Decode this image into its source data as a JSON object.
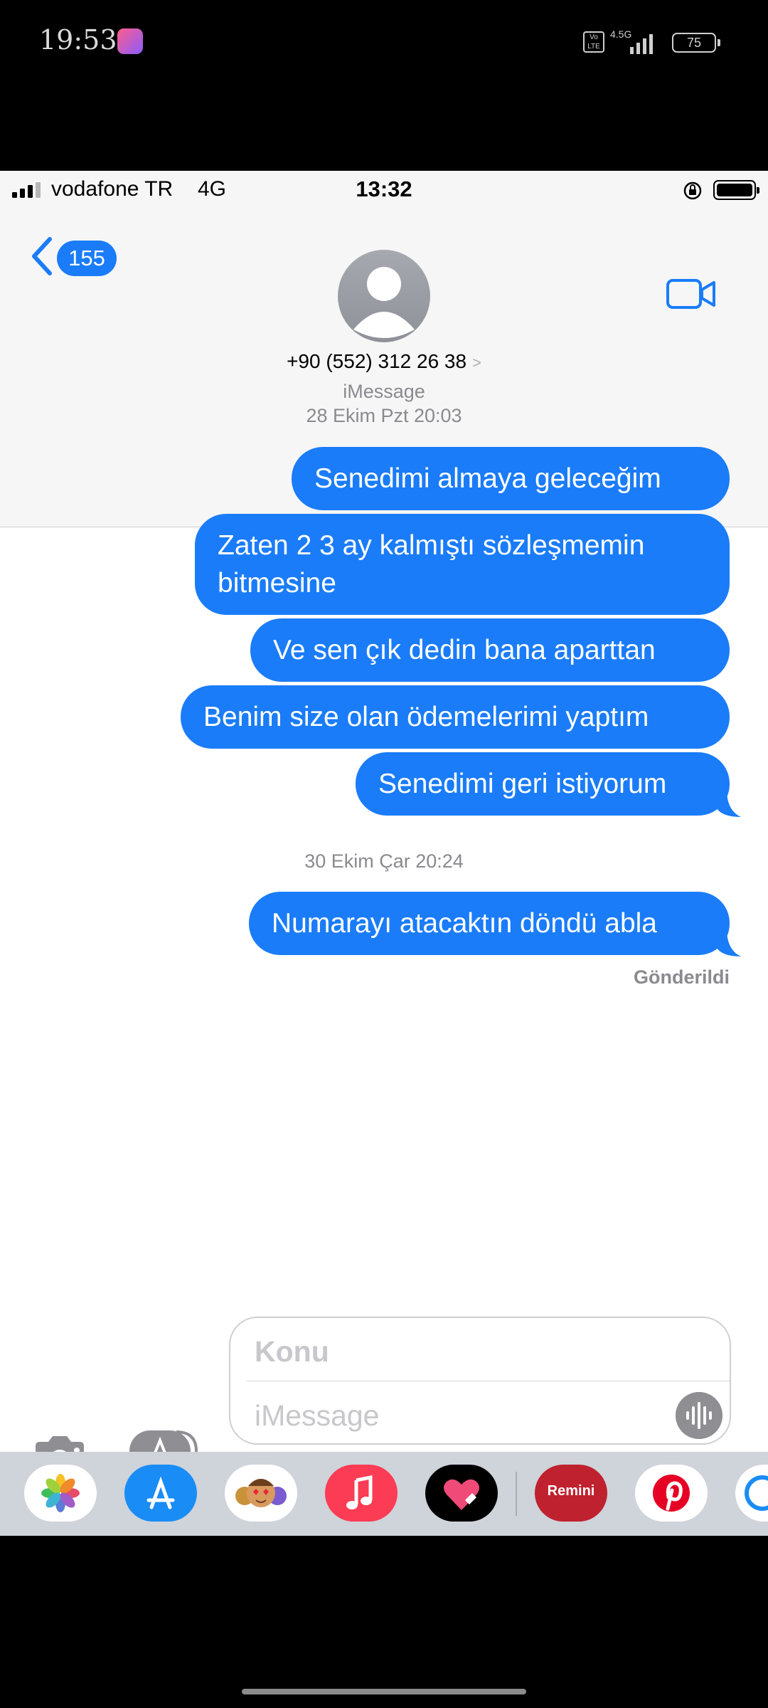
{
  "android_status": {
    "time": "19:53",
    "volte": "Vo LTE",
    "network": "4.5G",
    "battery": "75"
  },
  "ios_status": {
    "carrier": "vodafone TR",
    "network": "4G",
    "time": "13:32"
  },
  "nav": {
    "back_count": "155",
    "contact": "+90 (552) 312 26 38",
    "contact_chevron": ">"
  },
  "conversation": {
    "service": "iMessage",
    "groups": [
      {
        "timestamp": "28 Ekim Pzt 20:03",
        "messages": [
          {
            "text": "Senedimi almaya geleceğim"
          },
          {
            "text": "Zaten 2 3 ay kalmıştı sözleşmemin bitmesine"
          },
          {
            "text": "Ve sen çık dedin bana aparttan"
          },
          {
            "text": "Benim size olan ödemelerimi yaptım"
          },
          {
            "text": "Senedimi geri istiyorum"
          }
        ]
      },
      {
        "timestamp": "30 Ekim Çar 20:24",
        "messages": [
          {
            "text": "Numarayı atacaktın döndü abla"
          }
        ]
      }
    ],
    "delivered": "Gönderildi"
  },
  "compose": {
    "subject_placeholder": "Konu",
    "message_placeholder": "iMessage"
  },
  "app_drawer": {
    "apps": [
      {
        "name": "photos-app-icon"
      },
      {
        "name": "app-store-icon"
      },
      {
        "name": "memoji-stickers-icon"
      },
      {
        "name": "music-app-icon"
      },
      {
        "name": "digital-touch-icon"
      },
      {
        "name": "remini-app-icon",
        "label": "Remini"
      },
      {
        "name": "pinterest-app-icon"
      }
    ]
  },
  "colors": {
    "bubble": "#1a7cf8",
    "accent": "#1a7cf8",
    "meta": "#8a8a8f"
  }
}
